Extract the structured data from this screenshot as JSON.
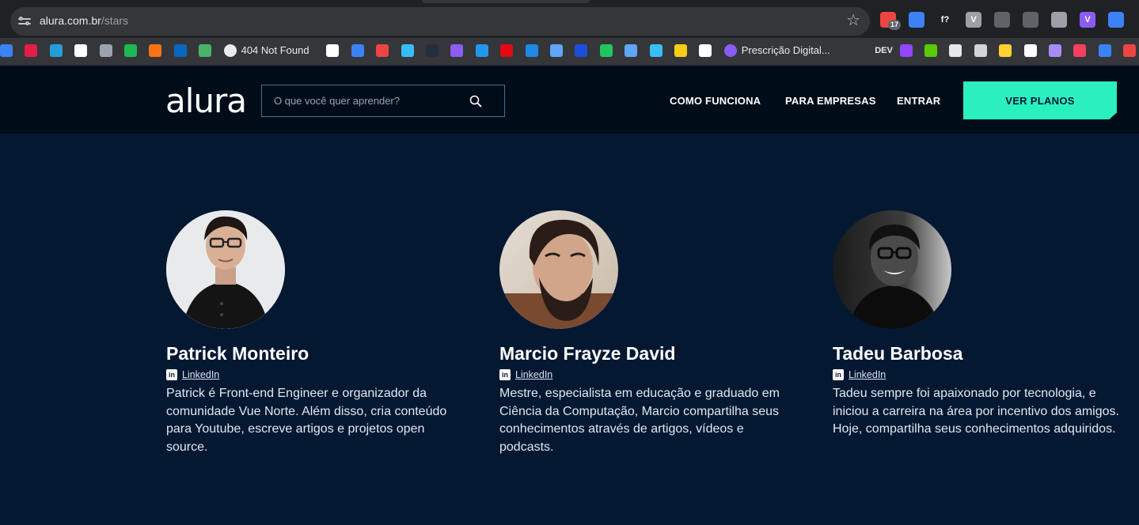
{
  "browser": {
    "url_host": "alura.com.br",
    "url_path": "/stars",
    "bookmarks": [
      {
        "icon": "google-drive-icon",
        "color": "#3b82f6"
      },
      {
        "icon": "vivaldi-icon",
        "color": "#e11d48"
      },
      {
        "icon": "telegram-icon",
        "color": "#229ed9"
      },
      {
        "icon": "trello-icon",
        "color": "#ffffff"
      },
      {
        "icon": "image-icon",
        "color": "#9ca3af"
      },
      {
        "icon": "spotify-icon",
        "color": "#1db954"
      },
      {
        "icon": "stack-icon",
        "color": "#f97316"
      },
      {
        "icon": "linkedin-icon",
        "color": "#0a66c2"
      },
      {
        "icon": "pushbullet-icon",
        "color": "#4ab367"
      },
      {
        "icon": "globe-icon",
        "label": "404 Not Found",
        "color": "#e8eaed"
      },
      {
        "icon": "github-icon",
        "color": "#ffffff"
      },
      {
        "icon": "play-icon",
        "color": "#3b82f6"
      },
      {
        "icon": "flame-icon",
        "color": "#ef4444"
      },
      {
        "icon": "tailwind-icon",
        "color": "#38bdf8"
      },
      {
        "icon": "aws-icon",
        "color": "#232f3e"
      },
      {
        "icon": "box-icon",
        "color": "#8b5cf6"
      },
      {
        "icon": "docker-icon",
        "color": "#2496ed"
      },
      {
        "icon": "netflix-icon",
        "color": "#e50914"
      },
      {
        "icon": "media-icon",
        "color": "#1e88e5"
      },
      {
        "icon": "tools-icon",
        "color": "#60a5fa"
      },
      {
        "icon": "n-icon",
        "color": "#1d4ed8"
      },
      {
        "icon": "chrome-icon",
        "color": "#22c55e"
      },
      {
        "icon": "duo-icon",
        "color": "#60a5fa"
      },
      {
        "icon": "bird-icon",
        "color": "#38bdf8"
      },
      {
        "icon": "coin-icon",
        "color": "#facc15"
      },
      {
        "icon": "clipboard-icon",
        "color": "#ffffff"
      },
      {
        "icon": "sparkle-icon",
        "label": "Prescrição Digital...",
        "color": "#8b5cf6"
      },
      {
        "icon": "dev-icon",
        "label": "DEV",
        "color": "#111827"
      },
      {
        "icon": "twitch-icon",
        "color": "#9146ff"
      },
      {
        "icon": "owl-icon",
        "color": "#58cc02"
      },
      {
        "icon": "chatgpt-icon",
        "color": "#e5e7eb"
      },
      {
        "icon": "openai-icon",
        "color": "#d1d5db"
      },
      {
        "icon": "miro-icon",
        "color": "#ffd02f"
      },
      {
        "icon": "notion-icon",
        "color": "#ffffff"
      },
      {
        "icon": "puzzle-icon",
        "color": "#a78bfa"
      },
      {
        "icon": "cube-icon",
        "color": "#f43f5e"
      },
      {
        "icon": "edge-icon",
        "color": "#3b82f6"
      },
      {
        "icon": "zap-icon",
        "color": "#ef4444"
      }
    ],
    "extensions": [
      {
        "icon": "notification-icon",
        "badge": "17",
        "color": "#ef4444"
      },
      {
        "icon": "screenshot-icon",
        "color": "#3b82f6"
      },
      {
        "icon": "fonts-icon",
        "label": "f?",
        "color": "#202124"
      },
      {
        "icon": "vue-icon",
        "label": "V",
        "color": "#9aa0a6"
      },
      {
        "icon": "gear-icon",
        "color": "#5f6368"
      },
      {
        "icon": "history-icon",
        "color": "#5f6368"
      },
      {
        "icon": "eyedropper-icon",
        "color": "#9aa0a6"
      },
      {
        "icon": "v-extension-icon",
        "label": "V",
        "color": "#8b5cf6"
      },
      {
        "icon": "file-icon",
        "color": "#3b82f6"
      }
    ]
  },
  "header": {
    "logo": "alura",
    "search_placeholder": "O que você quer aprender?",
    "nav": [
      "COMO FUNCIONA",
      "PARA EMPRESAS",
      "ENTRAR"
    ],
    "cta": "VER PLANOS"
  },
  "instructors": [
    {
      "name": "Patrick Monteiro",
      "link": "LinkedIn",
      "bio": "Patrick é Front-end Engineer e organizador da comunidade Vue Norte. Além disso, cria conteúdo para Youtube, escreve artigos e projetos open source."
    },
    {
      "name": "Marcio Frayze David",
      "link": "LinkedIn",
      "bio": "Mestre, especialista em educação e graduado em Ciência da Computação, Marcio compartilha seus conhecimentos através de artigos, vídeos e podcasts."
    },
    {
      "name": "Tadeu Barbosa",
      "link": "LinkedIn",
      "bio": "Tadeu sempre foi apaixonado por tecnologia, e iniciou a carreira na área por incentivo dos amigos. Hoje, compartilha seus conhecimentos adquiridos."
    }
  ],
  "colors": {
    "page_bg": "#041832",
    "header_bg": "#010c19",
    "accent": "#2af0c0"
  }
}
